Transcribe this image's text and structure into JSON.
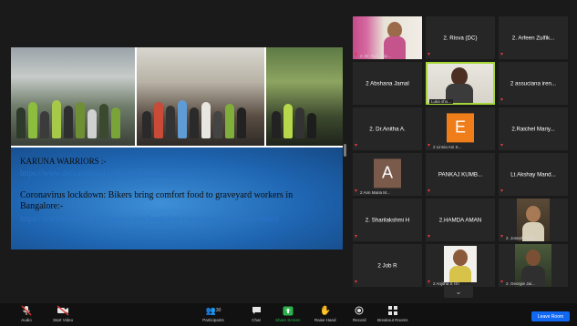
{
  "share": {
    "slide": {
      "heading1": "KARUNA WARRIORS :-",
      "link1": "https://www.deccanherald.com/city/karuna-warriors",
      "heading2": "Coronavirus lockdown: Bikers bring comfort food to graveyard workers in Bangalore:-",
      "link2": "https://www.thehindu.com/news/cities/bangalore/coronavirus-lockdown-bikers"
    }
  },
  "gallery": {
    "tiles": [
      {
        "name": "",
        "caption": "2. Dr. Nyo...Ric..."
      },
      {
        "name": "2. Risva (DC)",
        "caption": ""
      },
      {
        "name": "2. Arfeen Zulfik...",
        "caption": ""
      },
      {
        "name": "2 Abshana Jamal",
        "caption": ""
      },
      {
        "name": "",
        "caption": "Luka sho..."
      },
      {
        "name": "2 assuciana iren...",
        "caption": ""
      },
      {
        "name": "2. Dr.Anitha A.",
        "caption": ""
      },
      {
        "name": "",
        "caption": "2 Linnia Ani S...",
        "letter": "E"
      },
      {
        "name": "2.Raichel Mariy...",
        "caption": ""
      },
      {
        "name": "",
        "caption": "2 Ann Maria M...",
        "letter": "A"
      },
      {
        "name": "PANKAJ KUMB...",
        "caption": ""
      },
      {
        "name": "Lt.Akshay Mand...",
        "caption": ""
      },
      {
        "name": "2. Sharilakshmi H",
        "caption": ""
      },
      {
        "name": "2.HAMDA AMAN",
        "caption": ""
      },
      {
        "name": "",
        "caption": "2. Joseph Math..."
      },
      {
        "name": "2 Job R",
        "caption": ""
      },
      {
        "name": "",
        "caption": "2 Anjitha S (S)"
      },
      {
        "name": "",
        "caption": "2. Georgie Jai..."
      }
    ],
    "more_icon": "chevron-down-icon"
  },
  "toolbar": {
    "audio": "Audio",
    "start_video": "Start Video",
    "participants": "Participants",
    "participants_count": "30",
    "chat": "Chat",
    "share_screen": "Share Screen",
    "raise_hand": "Raise Hand",
    "record": "Record",
    "breakout": "Breakout Rooms",
    "leave": "Leave Room"
  },
  "colors": {
    "accent_green": "#a6d63a",
    "leave_blue": "#1168f2",
    "mute_red": "#e53935",
    "slide_blue": "#1f66b3"
  }
}
